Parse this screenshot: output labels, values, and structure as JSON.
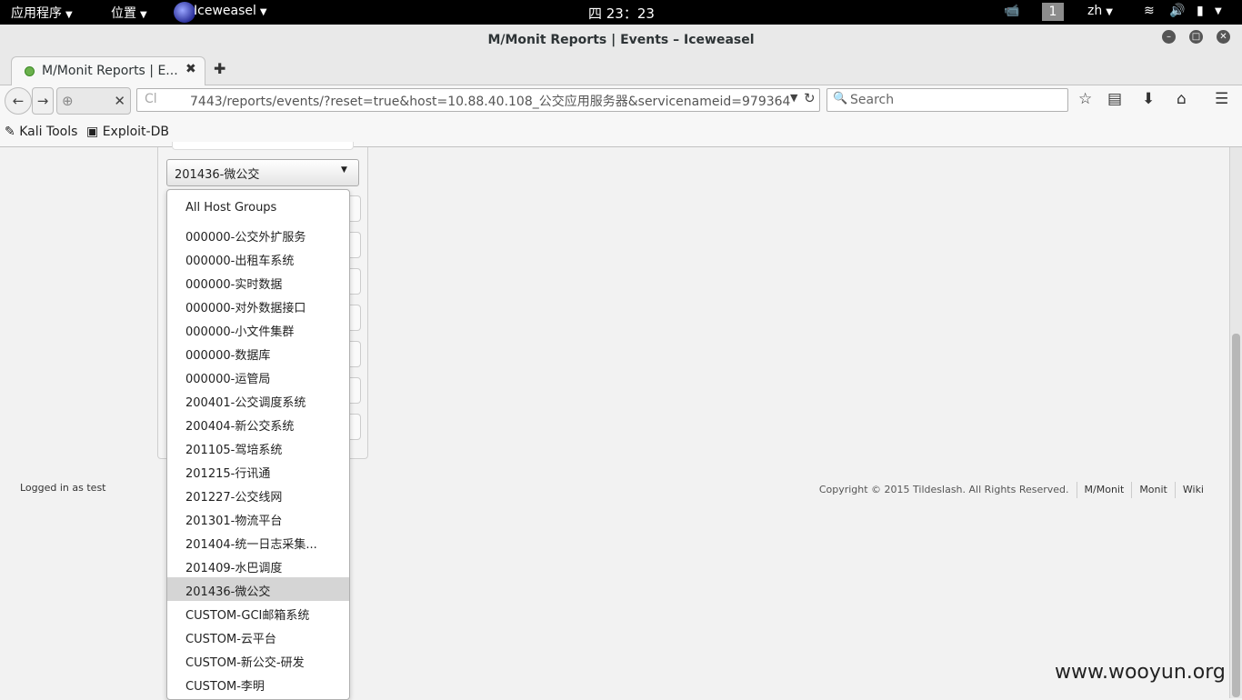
{
  "topbar": {
    "apps_menu": "应用程序",
    "places_menu": "位置",
    "app_name": "Iceweasel",
    "clock": "四 23：23",
    "workspace": "1",
    "lang": "zh"
  },
  "window": {
    "title": "M/Monit Reports | Events – Iceweasel"
  },
  "tab": {
    "label": "M/Monit Reports | E..."
  },
  "nav": {
    "url_prefix": "Cl",
    "url": "7443/reports/events/?reset=true&host=10.88.40.108_公交应用服务器&servicenameid=979364",
    "search_placeholder": "Search"
  },
  "bookmarks": [
    {
      "label": "Kali Tools"
    },
    {
      "label": "Exploit-DB"
    }
  ],
  "page": {
    "host_group_select": "201436-微公交",
    "host_group_options": [
      "All Host Groups",
      "000000-公交外扩服务",
      "000000-出租车系统",
      "000000-实时数据",
      "000000-对外数据接口",
      "000000-小文件集群",
      "000000-数据库",
      "000000-运管局",
      "200401-公交调度系统",
      "200404-新公交系统",
      "201105-驾培系统",
      "201215-行讯通",
      "201227-公交线网",
      "201301-物流平台",
      "201404-统一日志采集...",
      "201409-水巴调度",
      "201436-微公交",
      "CUSTOM-GCI邮箱系统",
      "CUSTOM-云平台",
      "CUSTOM-新公交-研发",
      "CUSTOM-李明"
    ],
    "selected_index": 16,
    "footer_left": "Logged in as test",
    "copyright": "Copyright © 2015 Tildeslash. All Rights Reserved.",
    "footer_links": [
      "M/Monit",
      "Monit",
      "Wiki"
    ],
    "watermark": "www.wooyun.org"
  }
}
